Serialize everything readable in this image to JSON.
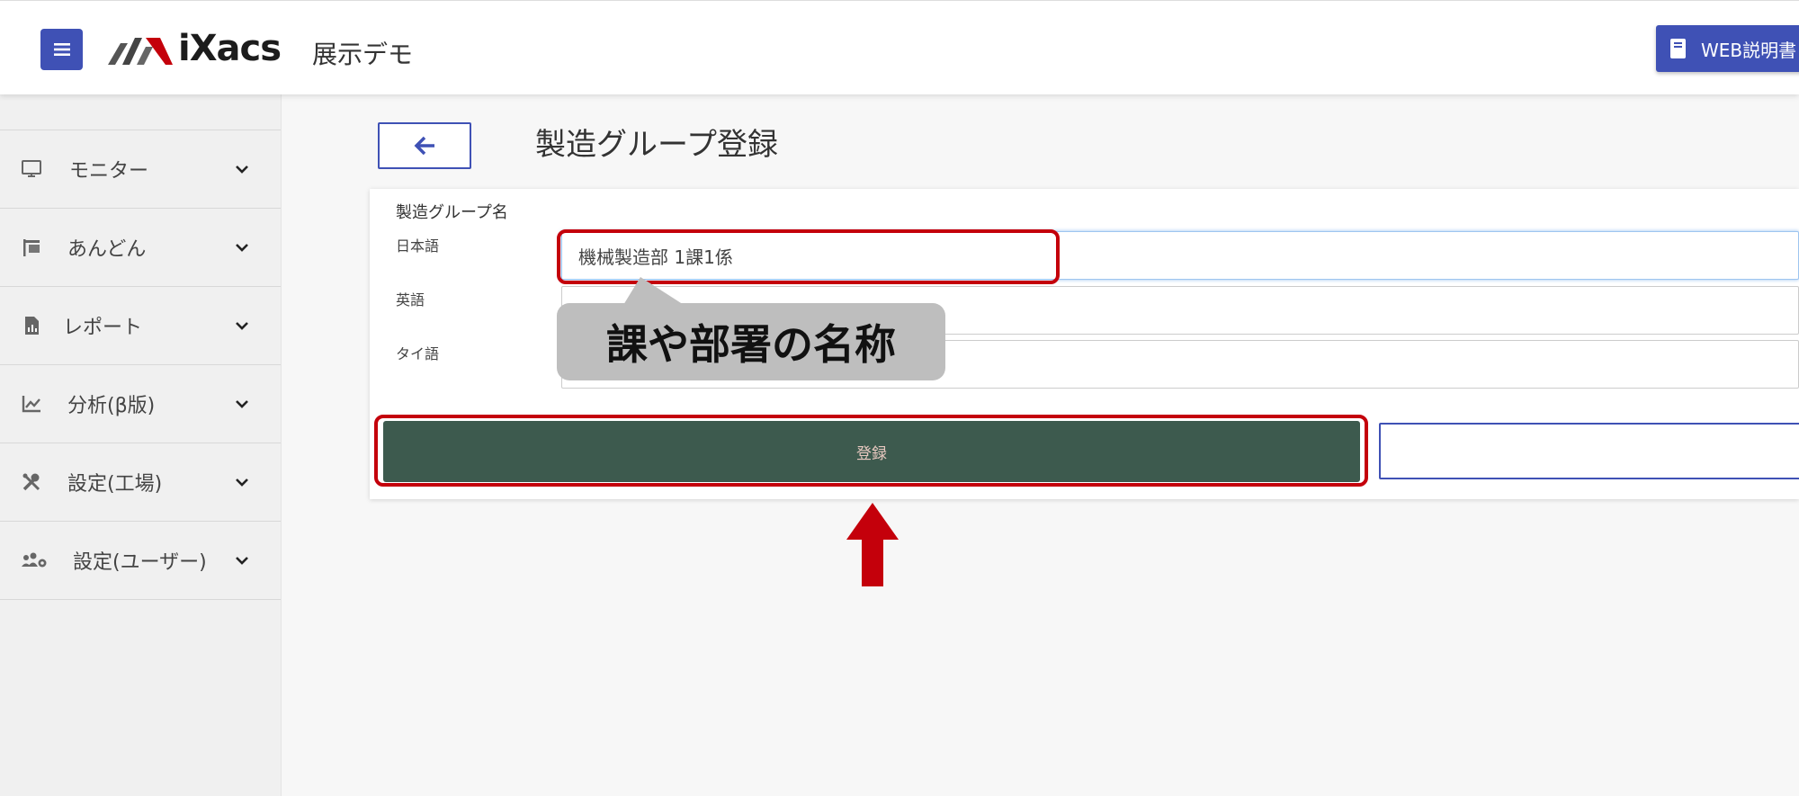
{
  "header": {
    "logo_text": "iXacs",
    "site_name": "展示デモ",
    "web_manual_label": "WEB説明書"
  },
  "sidebar": {
    "items": [
      {
        "label": "モニター",
        "icon": "monitor-icon"
      },
      {
        "label": "あんどん",
        "icon": "flag-icon"
      },
      {
        "label": "レポート",
        "icon": "report-icon"
      },
      {
        "label": "分析(β版)",
        "icon": "chart-icon"
      },
      {
        "label": "設定(工場)",
        "icon": "tools-icon"
      },
      {
        "label": "設定(ユーザー)",
        "icon": "users-gear-icon"
      }
    ]
  },
  "main": {
    "page_title": "製造グループ登録",
    "form": {
      "group_name_label": "製造グループ名",
      "fields": [
        {
          "label": "日本語",
          "value": "機械製造部 1課1係"
        },
        {
          "label": "英語",
          "value": ""
        },
        {
          "label": "タイ語",
          "value": ""
        }
      ],
      "register_label": "登録"
    },
    "callout_text": "課や部署の名称"
  },
  "colors": {
    "primary": "#3f51b5",
    "register_bg": "#3d5a4e",
    "highlight": "#c4000b",
    "callout_bg": "#bebebe"
  }
}
